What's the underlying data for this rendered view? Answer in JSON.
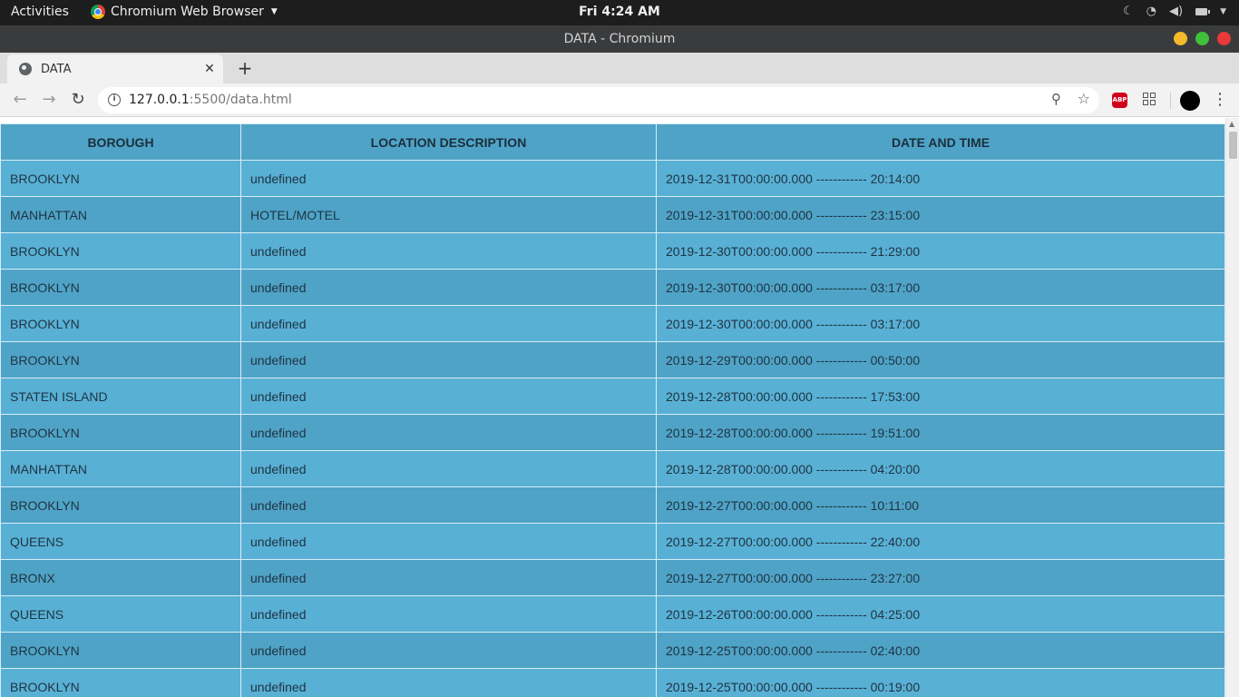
{
  "system_bar": {
    "activities": "Activities",
    "app_name": "Chromium Web Browser",
    "clock": "Fri  4:24 AM"
  },
  "window": {
    "title": "DATA - Chromium"
  },
  "tabs": [
    {
      "label": "DATA"
    }
  ],
  "address_bar": {
    "url_host": "127.0.0.1",
    "url_rest": ":5500/data.html"
  },
  "extensions": {
    "adblock_label": "ABP"
  },
  "table": {
    "headers": [
      "BOROUGH",
      "LOCATION DESCRIPTION",
      "DATE AND TIME"
    ],
    "rows": [
      [
        "BROOKLYN",
        "undefined",
        "2019-12-31T00:00:00.000 ------------ 20:14:00"
      ],
      [
        "MANHATTAN",
        "HOTEL/MOTEL",
        "2019-12-31T00:00:00.000 ------------ 23:15:00"
      ],
      [
        "BROOKLYN",
        "undefined",
        "2019-12-30T00:00:00.000 ------------ 21:29:00"
      ],
      [
        "BROOKLYN",
        "undefined",
        "2019-12-30T00:00:00.000 ------------ 03:17:00"
      ],
      [
        "BROOKLYN",
        "undefined",
        "2019-12-30T00:00:00.000 ------------ 03:17:00"
      ],
      [
        "BROOKLYN",
        "undefined",
        "2019-12-29T00:00:00.000 ------------ 00:50:00"
      ],
      [
        "STATEN ISLAND",
        "undefined",
        "2019-12-28T00:00:00.000 ------------ 17:53:00"
      ],
      [
        "BROOKLYN",
        "undefined",
        "2019-12-28T00:00:00.000 ------------ 19:51:00"
      ],
      [
        "MANHATTAN",
        "undefined",
        "2019-12-28T00:00:00.000 ------------ 04:20:00"
      ],
      [
        "BROOKLYN",
        "undefined",
        "2019-12-27T00:00:00.000 ------------ 10:11:00"
      ],
      [
        "QUEENS",
        "undefined",
        "2019-12-27T00:00:00.000 ------------ 22:40:00"
      ],
      [
        "BRONX",
        "undefined",
        "2019-12-27T00:00:00.000 ------------ 23:27:00"
      ],
      [
        "QUEENS",
        "undefined",
        "2019-12-26T00:00:00.000 ------------ 04:25:00"
      ],
      [
        "BROOKLYN",
        "undefined",
        "2019-12-25T00:00:00.000 ------------ 02:40:00"
      ],
      [
        "BROOKLYN",
        "undefined",
        "2019-12-25T00:00:00.000 ------------ 00:19:00"
      ]
    ]
  },
  "colors": {
    "row_light": "#58b0d5",
    "row_dark": "#4fa3c7",
    "header_bg": "#4fa3c7"
  }
}
